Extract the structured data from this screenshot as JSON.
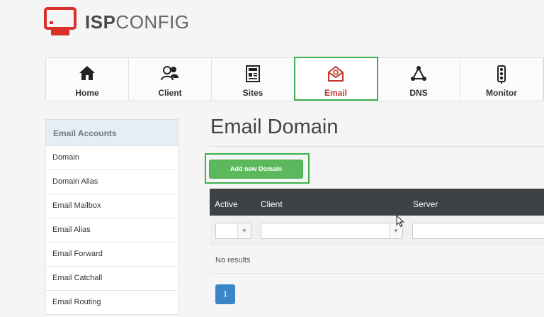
{
  "logo": {
    "text_bold": "ISP",
    "text_regular": "CONFIG"
  },
  "topnav": [
    {
      "label": "Home",
      "icon": "home-icon"
    },
    {
      "label": "Client",
      "icon": "users-icon"
    },
    {
      "label": "Sites",
      "icon": "sites-icon"
    },
    {
      "label": "Email",
      "icon": "email-icon",
      "active": true
    },
    {
      "label": "DNS",
      "icon": "dns-icon"
    },
    {
      "label": "Monitor",
      "icon": "traffic-light-icon"
    }
  ],
  "sidebar": {
    "heading": "Email Accounts",
    "items": [
      {
        "label": "Domain"
      },
      {
        "label": "Domain Alias"
      },
      {
        "label": "Email Mailbox"
      },
      {
        "label": "Email Alias"
      },
      {
        "label": "Email Forward"
      },
      {
        "label": "Email Catchall"
      },
      {
        "label": "Email Routing"
      }
    ]
  },
  "main": {
    "title": "Email Domain",
    "add_button": "Add new Domain",
    "columns": [
      "Active",
      "Client",
      "Server"
    ],
    "no_results": "No results",
    "page_number": "1"
  },
  "colors": {
    "accent_green": "#5cb85c",
    "highlight_green": "#3cb04a",
    "table_header": "#3e4146",
    "active_red": "#c0392b",
    "pager_blue": "#3a87c8"
  }
}
